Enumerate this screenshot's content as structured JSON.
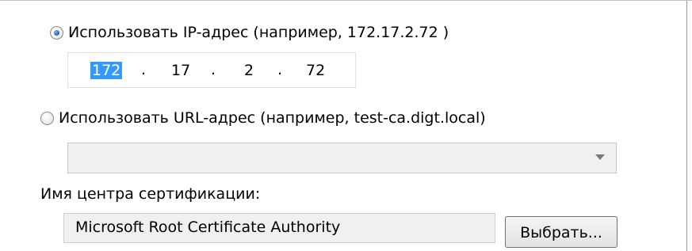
{
  "ip_option": {
    "label": "Использовать IP-адрес (например, 172.17.2.72 )",
    "selected": true
  },
  "ip_address": {
    "octet1": "172",
    "octet2": "17",
    "octet3": "2",
    "octet4": "72",
    "separator": "."
  },
  "url_option": {
    "label": "Использовать URL-адрес (например, test-ca.digt.local)",
    "selected": false
  },
  "url_combo": {
    "value": ""
  },
  "ca": {
    "label": "Имя центра сертификации:",
    "value": "Microsoft Root Certificate Authority",
    "choose_button": "Выбрать..."
  },
  "icons": {
    "radio_checked": "radio-checked-icon",
    "radio_unchecked": "radio-unchecked-icon",
    "dropdown": "chevron-down-icon"
  }
}
